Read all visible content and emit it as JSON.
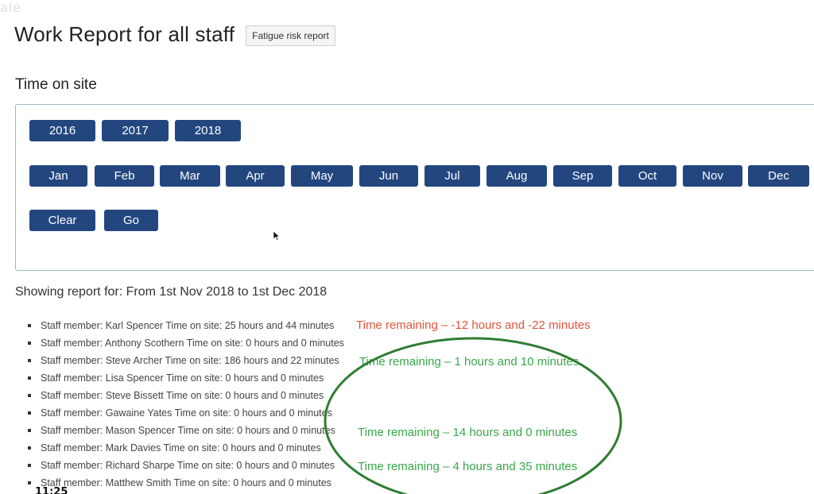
{
  "page": {
    "corner_mark": "ale",
    "title": "Work Report for all staff",
    "fatigue_button": "Fatigue risk report",
    "section_title": "Time on site"
  },
  "years": [
    "2016",
    "2017",
    "2018"
  ],
  "months": [
    "Jan",
    "Feb",
    "Mar",
    "Apr",
    "May",
    "Jun",
    "Jul",
    "Aug",
    "Sep",
    "Oct",
    "Nov",
    "Dec"
  ],
  "actions": {
    "clear": "Clear",
    "go": "Go"
  },
  "colors": {
    "button_bg": "#23467f",
    "negative": "#e0533a",
    "positive": "#3aa84a",
    "ellipse": "#2e7d32"
  },
  "report": {
    "showing": "Showing report for: From 1st Nov 2018 to 1st Dec 2018",
    "staff": [
      "Staff member: Karl Spencer Time on site: 25 hours and 44 minutes",
      "Staff member: Anthony Scothern Time on site: 0 hours and 0 minutes",
      "Staff member: Steve Archer Time on site: 186 hours and 22 minutes",
      "Staff member: Lisa Spencer Time on site: 0 hours and 0 minutes",
      "Staff member: Steve Bissett Time on site: 0 hours and 0 minutes",
      "Staff member: Gawaine Yates Time on site: 0 hours and 0 minutes",
      "Staff member: Mason Spencer Time on site: 0 hours and 0 minutes",
      "Staff member: Mark Davies Time on site: 0 hours and 0 minutes",
      "Staff member: Richard Sharpe Time on site: 0 hours and 0 minutes",
      "Staff member: Matthew Smith Time on site: 0 hours and 0 minutes"
    ],
    "remaining": {
      "karl": "Time remaining –  -12 hours and -22 minutes",
      "steve_archer": "Time remaining – 1 hours and 10 minutes",
      "mason": "Time remaining – 14 hours and 0 minutes",
      "richard": "Time remaining – 4 hours and 35 minutes"
    }
  },
  "timestamp": "11:25"
}
